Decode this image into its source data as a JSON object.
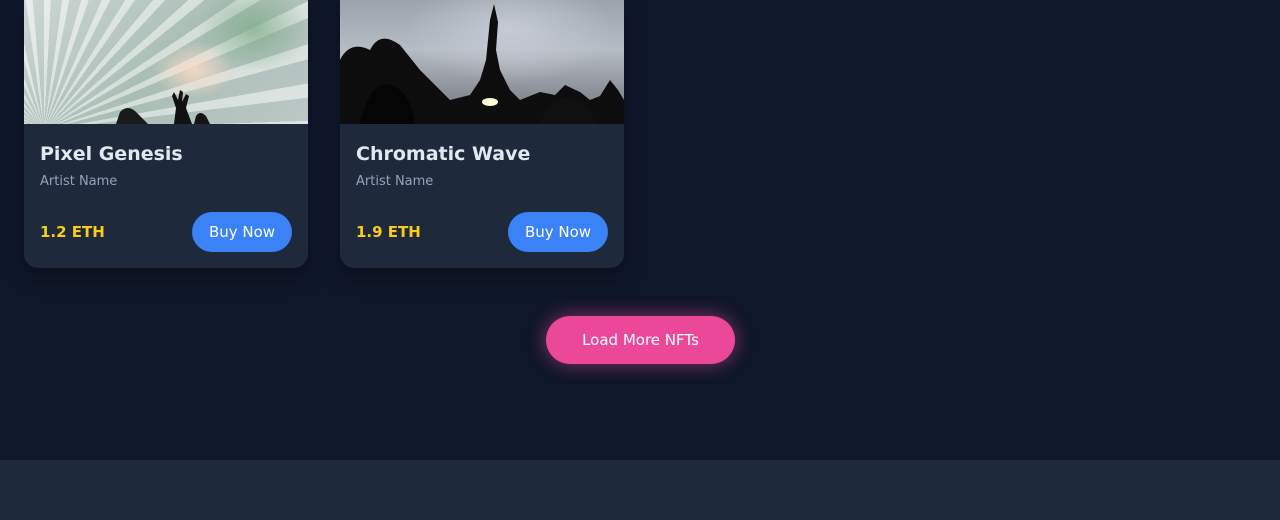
{
  "nfts": [
    {
      "title": "Pixel Genesis",
      "artist": "Artist Name",
      "price": "1.2 ETH",
      "button_label": "Buy Now"
    },
    {
      "title": "Chromatic Wave",
      "artist": "Artist Name",
      "price": "1.9 ETH",
      "button_label": "Buy Now"
    }
  ],
  "load_more": {
    "label": "Load More NFTs"
  },
  "colors": {
    "background": "#0f172a",
    "card": "#1e293b",
    "price": "#facc15",
    "buy_button": "#3b82f6",
    "load_more": "#ec4899"
  }
}
